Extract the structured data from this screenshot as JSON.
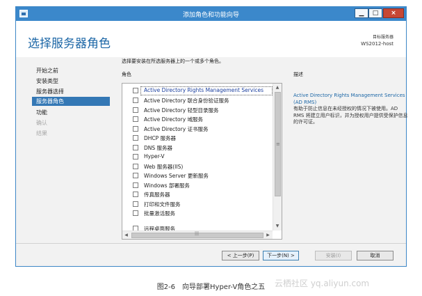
{
  "window": {
    "title": "添加角色和功能向导",
    "min_label": "▁",
    "max_label": "□",
    "close_label": "×"
  },
  "header": {
    "page_title": "选择服务器角色",
    "server_caption": "目标服务器",
    "server_name": "WS2012-host"
  },
  "nav": {
    "items": [
      {
        "label": "开始之前",
        "state": "normal"
      },
      {
        "label": "安装类型",
        "state": "normal"
      },
      {
        "label": "服务器选择",
        "state": "normal"
      },
      {
        "label": "服务器角色",
        "state": "active"
      },
      {
        "label": "功能",
        "state": "normal"
      },
      {
        "label": "确认",
        "state": "disabled"
      },
      {
        "label": "结果",
        "state": "disabled"
      }
    ]
  },
  "main": {
    "intro": "选择要安装在所选服务器上的一个或多个角色。",
    "roles_label": "角色",
    "roles": [
      {
        "label": "Active Directory Rights Management Services",
        "checked": false,
        "selected": true
      },
      {
        "label": "Active Directory 联合身份验证服务",
        "checked": false
      },
      {
        "label": "Active Directory 轻型目录服务",
        "checked": false
      },
      {
        "label": "Active Directory 域服务",
        "checked": false
      },
      {
        "label": "Active Directory 证书服务",
        "checked": false
      },
      {
        "label": "DHCP 服务器",
        "checked": false
      },
      {
        "label": "DNS 服务器",
        "checked": false
      },
      {
        "label": "Hyper-V",
        "checked": false
      },
      {
        "label": "Web 服务器(IIS)",
        "checked": false
      },
      {
        "label": "Windows Server 更新服务",
        "checked": false
      },
      {
        "label": "Windows 部署服务",
        "checked": false
      },
      {
        "label": "传真服务器",
        "checked": false
      },
      {
        "label": "打印和文件服务",
        "checked": false
      },
      {
        "label": "批量激活服务",
        "checked": false
      },
      {
        "label": "远程桌面服务",
        "checked": false
      }
    ],
    "scroll": {
      "up": "▲",
      "down": "▼",
      "left": "◀",
      "right": "▶",
      "grip_v": "≡",
      "grip_h": "|||"
    }
  },
  "description": {
    "label": "描述",
    "title": "Active Directory Rights Management Services (AD RMS)",
    "text": "有助于防止信息在未经授权的情况下被使用。AD RMS 将建立用户标识，并为授权用户提供受保护信息的许可证。"
  },
  "buttons": {
    "prev": "< 上一步(P)",
    "next": "下一步(N) >",
    "install": "安装(I)",
    "cancel": "取消"
  },
  "caption": "图2-6　向导部署Hyper-V角色之五",
  "watermark": "云栖社区 yq.aliyun.com",
  "colors": {
    "titlebar": "#3b88cb",
    "accent": "#1b66a6",
    "nav_active": "#3478b5",
    "close_button": "#c74734"
  }
}
